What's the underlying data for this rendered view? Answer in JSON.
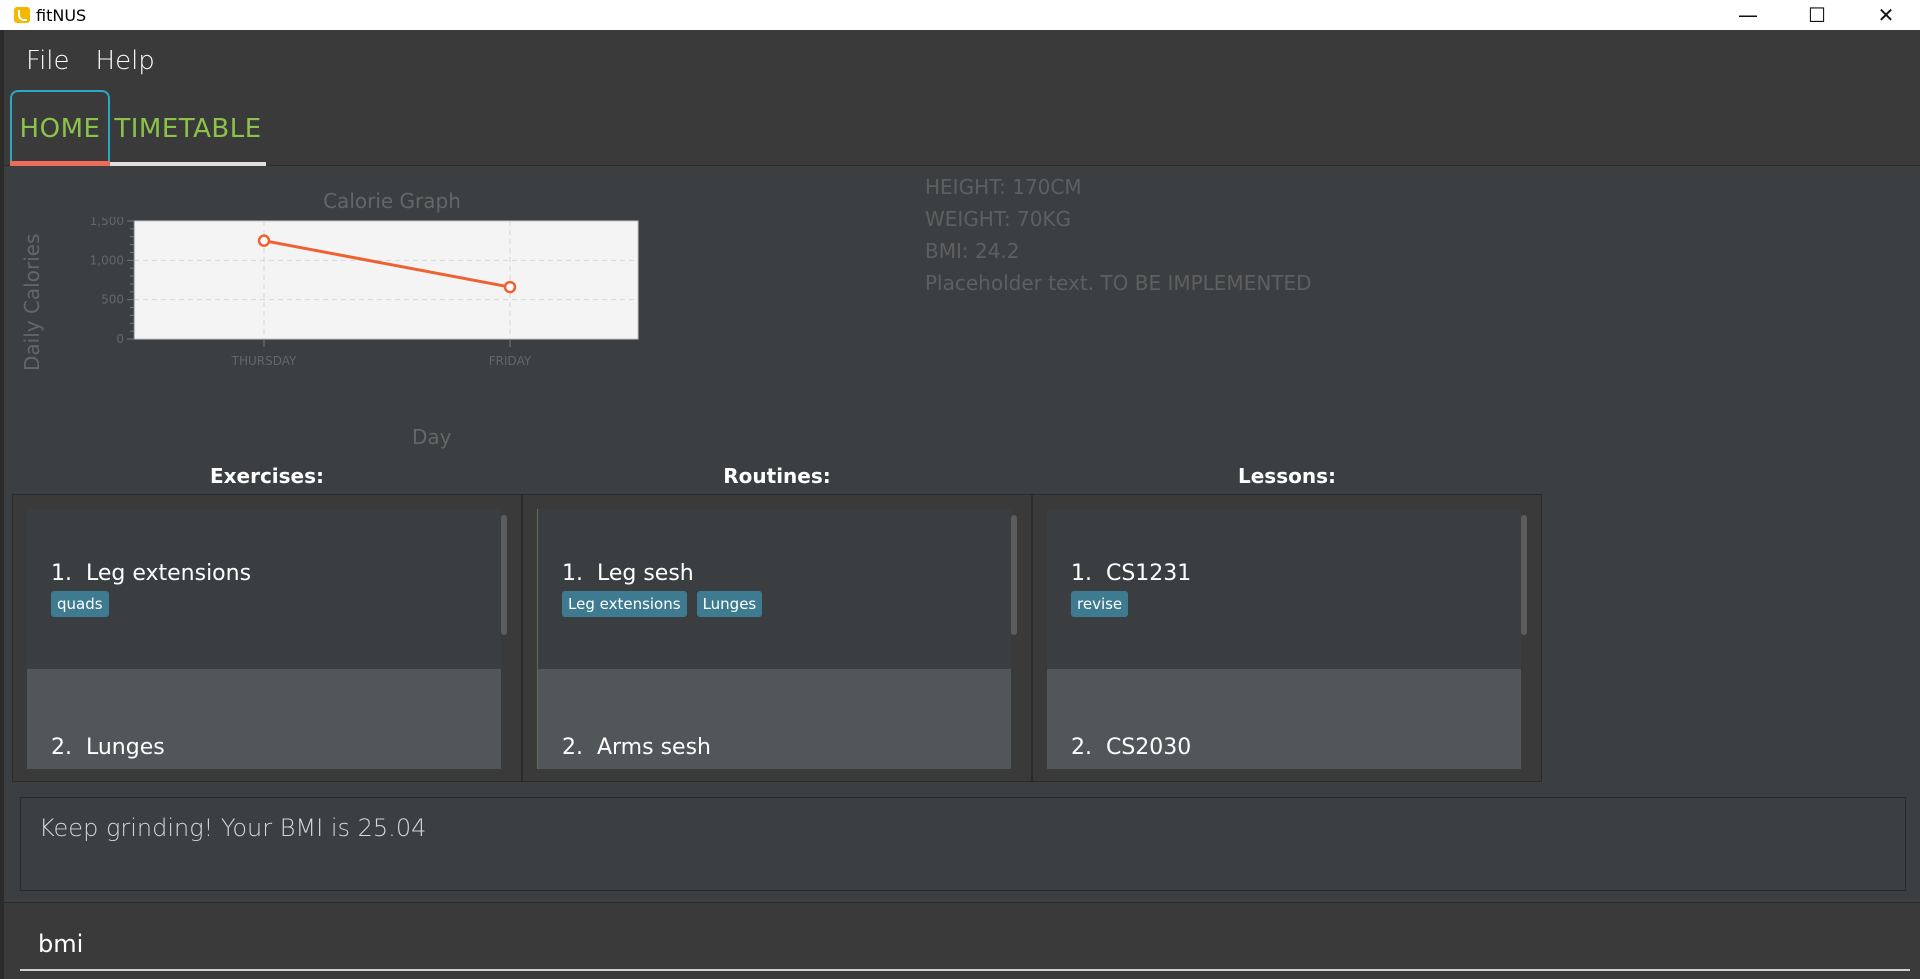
{
  "window": {
    "title": "fitNUS",
    "icon": "bicep-app-icon"
  },
  "window_controls": {
    "minimize": "—",
    "maximize": "☐",
    "close": "✕"
  },
  "menu": {
    "file": "File",
    "help": "Help"
  },
  "tabs": [
    {
      "label": "HOME",
      "selected": true
    },
    {
      "label": "TIMETABLE",
      "selected": false
    }
  ],
  "chart_data": {
    "type": "line",
    "title": "Calorie Graph",
    "xlabel": "Day",
    "ylabel": "Daily Calories",
    "categories": [
      "THURSDAY",
      "FRIDAY"
    ],
    "values": [
      1250,
      660
    ],
    "ylim": [
      0,
      1500
    ],
    "yticks": [
      "0",
      "500",
      "1,000",
      "1,500"
    ],
    "grid": true,
    "line_color": "#f06030"
  },
  "stats": {
    "height": "HEIGHT: 170CM",
    "weight": "WEIGHT: 70KG",
    "bmi": "BMI: 24.2",
    "placeholder": "Placeholder text. TO BE IMPLEMENTED"
  },
  "panels": {
    "exercises": {
      "title": "Exercises:",
      "items": [
        {
          "label": "1.  Leg extensions",
          "tags": [
            "quads"
          ]
        },
        {
          "label": "2.  Lunges",
          "tags": []
        }
      ]
    },
    "routines": {
      "title": "Routines:",
      "items": [
        {
          "label": "1.  Leg sesh",
          "tags": [
            "Leg extensions",
            "Lunges"
          ]
        },
        {
          "label": "2.  Arms sesh",
          "tags": []
        }
      ]
    },
    "lessons": {
      "title": "Lessons:",
      "items": [
        {
          "label": "1.  CS1231",
          "tags": [
            "revise"
          ]
        },
        {
          "label": "2.  CS2030",
          "tags": []
        }
      ]
    }
  },
  "result": {
    "text": "Keep grinding! Your BMI is 25.04"
  },
  "command": {
    "value": "bmi",
    "placeholder": ""
  }
}
